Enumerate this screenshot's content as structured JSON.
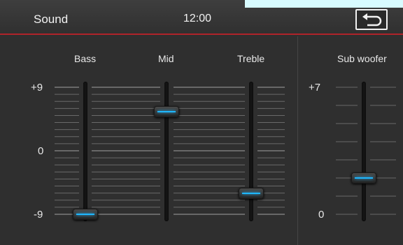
{
  "header": {
    "title": "Sound",
    "time": "12:00",
    "back_icon": "return-arrow-icon"
  },
  "eq": {
    "scale": {
      "max_label": "+9",
      "mid_label": "0",
      "min_label": "-9",
      "max": 9,
      "min": -9
    },
    "bands": [
      {
        "label": "Bass",
        "value": -9
      },
      {
        "label": "Mid",
        "value": 5.5
      },
      {
        "label": "Treble",
        "value": -6
      }
    ]
  },
  "subwoofer": {
    "label": "Sub woofer",
    "max_label": "+7",
    "min_label": "0",
    "max": 7,
    "min": 0,
    "value": 2
  },
  "colors": {
    "accent": "#1fb7ff",
    "header_line": "#b0232a",
    "background": "#2f2f2f"
  }
}
